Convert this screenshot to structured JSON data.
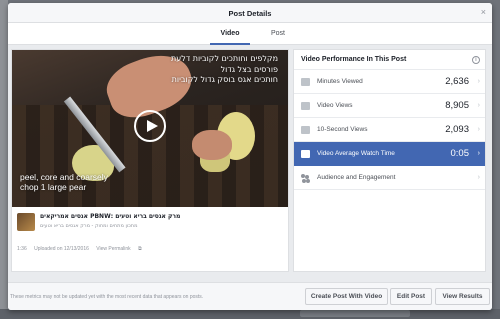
{
  "modal": {
    "title": "Post Details",
    "close_glyph": "×"
  },
  "tabs": [
    {
      "label": "Video",
      "active": true
    },
    {
      "label": "Post",
      "active": false
    }
  ],
  "video": {
    "overlay_hebrew": [
      "מקלפים וחותכים לקוביות דלעת",
      "פורסים בצל גדול",
      "חותכים אגס בוסק גדול לקוביות"
    ],
    "overlay_english": [
      "peel, core and coarsely",
      "chop 1 large pear"
    ]
  },
  "post": {
    "title": "מרק אגסים בריא וטעים :PBNW אגסים אמריקאים",
    "subtitle": "מתכון מתחים ומחוק - מרק אגסים בריא וטעים",
    "duration": "1:36",
    "uploaded": "Uploaded on 12/13/2016",
    "permalink": "View Permalink"
  },
  "performance": {
    "header": "Video Performance In This Post",
    "rows": [
      {
        "label": "Minutes Viewed",
        "value": "2,636",
        "icon": "clock-icon"
      },
      {
        "label": "Video Views",
        "value": "8,905",
        "icon": "play-icon"
      },
      {
        "label": "10-Second Views",
        "value": "2,093",
        "icon": "ten-second-icon"
      },
      {
        "label": "Video Average Watch Time",
        "value": "0:05",
        "icon": "watch-time-icon",
        "active": true
      },
      {
        "label": "Audience and Engagement",
        "value": "",
        "icon": "people-icon"
      }
    ]
  },
  "footer": {
    "note": "These metrics may not be updated yet with the most recent data that appears on posts.",
    "buttons": {
      "create": "Create Post With Video",
      "edit": "Edit Post",
      "results": "View Results"
    }
  },
  "colors": {
    "accent": "#4267b2",
    "overlay": "#6f737a"
  }
}
